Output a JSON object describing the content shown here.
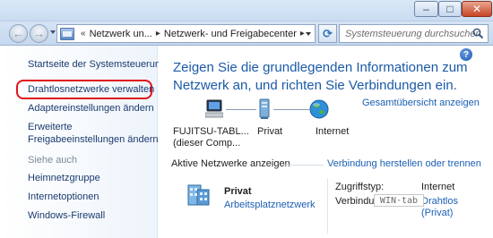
{
  "window": {
    "minimize_glyph": "–",
    "maximize_glyph": "□",
    "close_glyph": "✕"
  },
  "nav": {
    "back_glyph": "←",
    "forward_glyph": "→",
    "breadcrumb_prefix": "«",
    "breadcrumbs": [
      "Netzwerk un...",
      "Netzwerk- und Freigabecenter"
    ],
    "breadcrumb_separator": "▸",
    "refresh_glyph": "⟳",
    "search_placeholder": "Systemsteuerung durchsuchen"
  },
  "sidebar": {
    "home_link": "Startseite der Systemsteuerung",
    "items": [
      "Drahtlosnetzwerke verwalten",
      "Adaptereinstellungen ändern",
      "Erweiterte",
      "Freigabeeinstellungen ändern"
    ],
    "see_also_heading": "Siehe auch",
    "see_also": [
      "Heimnetzgruppe",
      "Internetoptionen",
      "Windows-Firewall"
    ]
  },
  "main": {
    "help_glyph": "?",
    "headline_line1": "Zeigen Sie die grundlegenden Informationen zum",
    "headline_line2": "Netzwerk an, und richten Sie Verbindungen ein.",
    "overview_link": "Gesamtübersicht anzeigen",
    "map": {
      "computer_line1": "FUJITSU-TABL...",
      "computer_line2": "(dieser Comp...",
      "network": "Privat",
      "internet": "Internet"
    },
    "active_section": "Aktive Netzwerke anzeigen",
    "connect_link": "Verbindung herstellen oder trennen",
    "active_network": {
      "name": "Privat",
      "type": "Arbeitsplatznetzwerk",
      "access_label": "Zugriffstyp:",
      "access_value": "Internet",
      "connections_label": "Verbindungen:",
      "connections_value": "Drahtlos",
      "connections_value2": "(Privat)"
    },
    "watermark": "WIN·tab"
  },
  "colors": {
    "link": "#1a5fb4",
    "headline": "#1b5aa8",
    "highlight": "#e0131b"
  }
}
